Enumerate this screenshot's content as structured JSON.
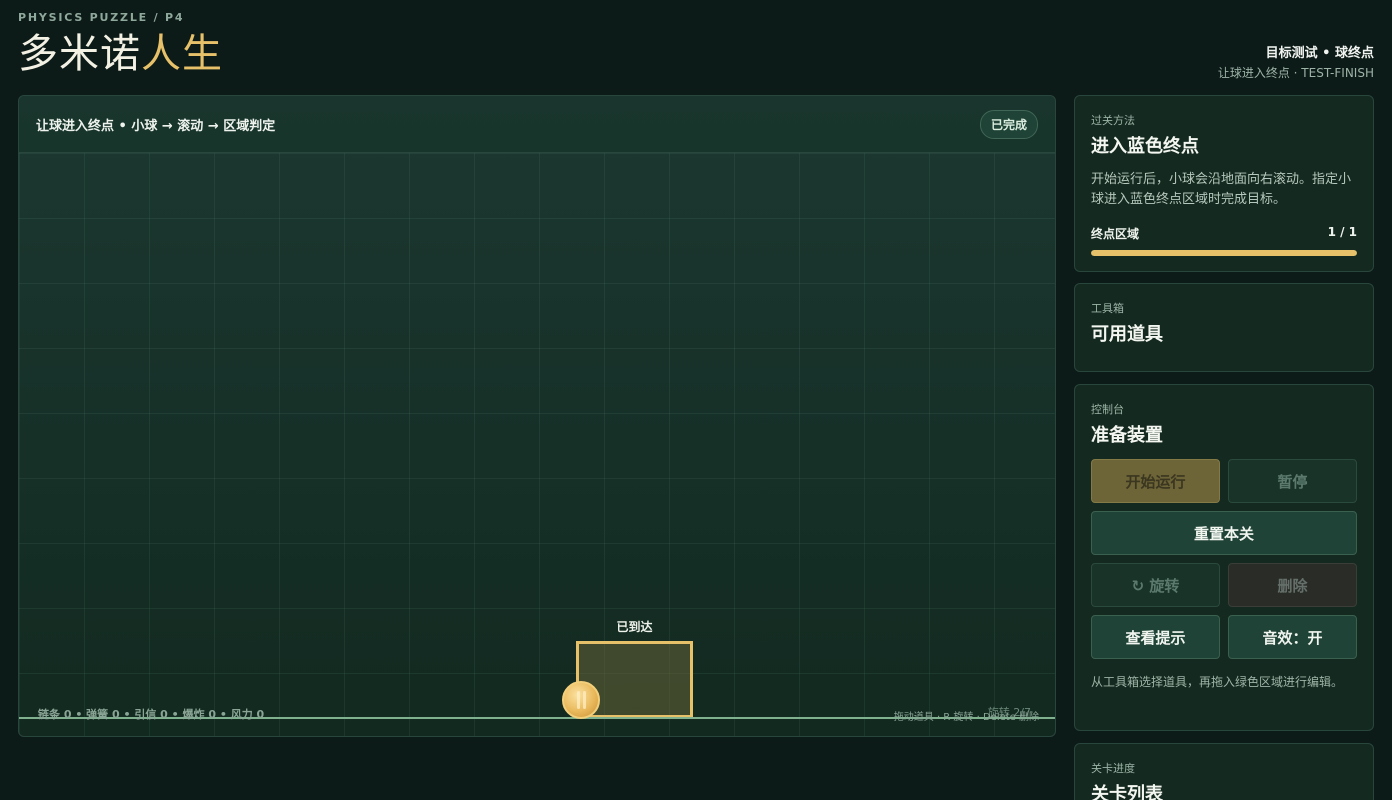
{
  "header": {
    "eyebrow": "PHYSICS PUZZLE / P4",
    "title_main": "多米诺",
    "title_accent": "人生",
    "level_name": "目标测试 • 球终点",
    "level_sub": "让球进入终点 · TEST-FINISH"
  },
  "stage": {
    "title": "让球进入终点 • 小球 → 滚动 → 区域判定",
    "status_badge": "已完成",
    "goal_label": "已到达",
    "stats": "链条 0 • 弹簧 0 • 引信 0 • 爆炸 0 • 风力 0",
    "hint": "拖动道具 · R 旋转 · Delete 删除",
    "rotation_readout": "旋转 2/7"
  },
  "objective": {
    "kicker": "过关方法",
    "title": "进入蓝色终点",
    "description": "开始运行后，小球会沿地面向右滚动。指定小球进入蓝色终点区域时完成目标。",
    "progress_label": "终点区域",
    "progress_value": "1 / 1",
    "progress_fraction": 1.0
  },
  "toolbox": {
    "kicker": "工具箱",
    "title": "可用道具"
  },
  "controls": {
    "kicker": "控制台",
    "title": "准备装置",
    "start": "开始运行",
    "pause": "暂停",
    "reset": "重置本关",
    "rotate": "↻ 旋转",
    "delete": "删除",
    "hint_button": "查看提示",
    "sound": "音效：开",
    "help_text": "从工具箱选择道具，再拖入绿色区域进行编辑。"
  },
  "levels": {
    "kicker": "关卡进度",
    "title": "关卡列表"
  },
  "colors": {
    "accent": "#e6c16a",
    "background": "#0d1b18",
    "ground": "#7fb18f"
  }
}
